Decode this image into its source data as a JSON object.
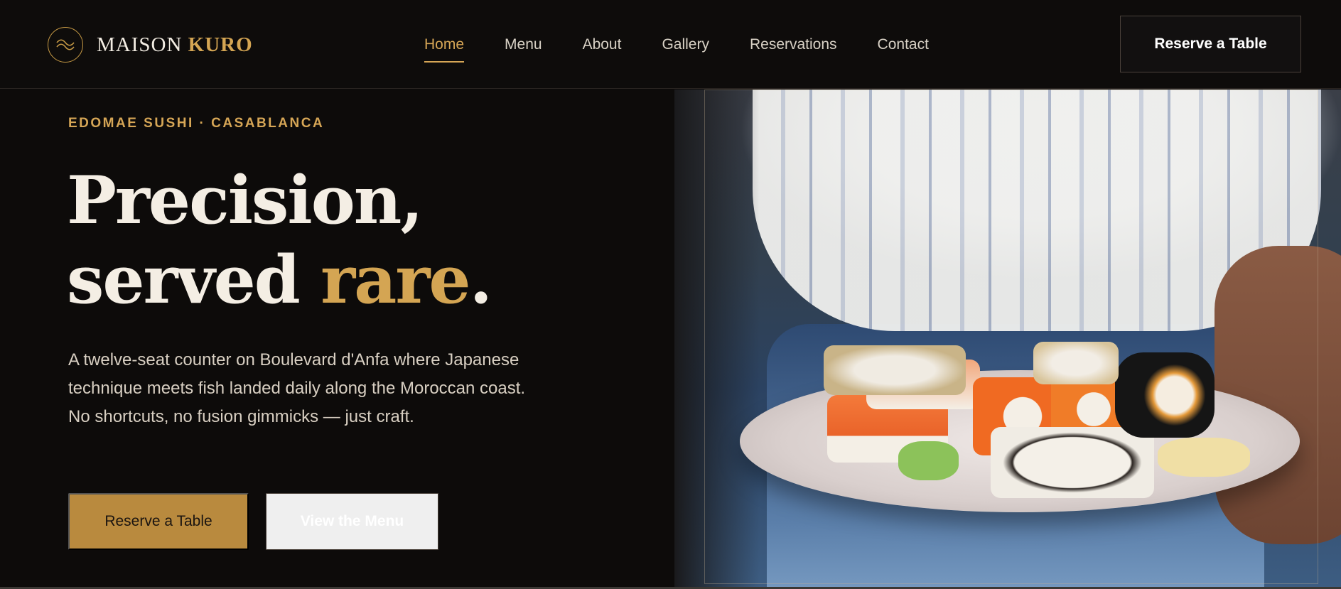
{
  "brand": {
    "name_part1": "MAISON",
    "name_part2": "KURO",
    "logo_icon": "wave-icon"
  },
  "nav": {
    "items": [
      {
        "label": "Home",
        "active": true
      },
      {
        "label": "Menu"
      },
      {
        "label": "About"
      },
      {
        "label": "Gallery"
      },
      {
        "label": "Reservations"
      },
      {
        "label": "Contact"
      }
    ],
    "cta_label": "Reserve a Table"
  },
  "hero": {
    "eyebrow": "EDOMAE SUSHI · CASABLANCA",
    "headline_line1": "Precision,",
    "headline_line2_a": "served ",
    "headline_line2_accent": "rare",
    "headline_line2_end": ".",
    "lede": "A twelve-seat counter on Boulevard d'Anfa where Japanese technique meets fish landed daily along the Moroccan coast. No shortcuts, no fusion gimmicks — just craft.",
    "primary_button": "Reserve a Table",
    "secondary_button": "View the Menu"
  },
  "colors": {
    "background": "#0d0b0a",
    "accent": "#d4a553",
    "button_gold": "#b98a3e"
  }
}
